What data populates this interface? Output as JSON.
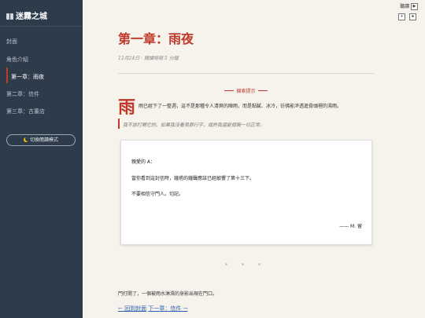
{
  "sidebar": {
    "brand": "迷霧之城",
    "items": [
      {
        "label": "封面"
      },
      {
        "label": "角色介紹"
      },
      {
        "label": "第一章：雨夜"
      },
      {
        "label": "第二章：信件"
      },
      {
        "label": "第三章：古董店"
      }
    ],
    "active_index": 2,
    "theme_button": "切換閱讀模式"
  },
  "topbar": {
    "label": "聽讀",
    "play_icon": "▶",
    "buttons": [
      "⏸",
      "⏹"
    ]
  },
  "chapter": {
    "title": "第一章：雨夜",
    "meta": "12月24日 · 閱讀時間 5 分鐘",
    "ornament": "線索提示",
    "dropcap": "雨",
    "para1": "雨已經下了一整週，這不是那種令人清爽的陣雨，而是黏膩、冰冷，彷彿能滲透進骨頭裡的濕雨。",
    "quote": "我不該打開它的，如果我沒看見那行字，或許我還能假裝一切正常。",
    "letter": {
      "greeting": "親愛的 A：",
      "line1": "當你看到這封信時，鐘塔的鐘聲應該已經敲響了第十三下。",
      "line2": "不要相信守門人。切記。",
      "signature": "—— M. 留"
    },
    "divider": "* * *",
    "para2": "門打開了，一個被雨水淋濕的身影出現在門口。",
    "prev_link": "← 回到封面",
    "next_link": "下一章：信件 →"
  },
  "colors": {
    "sidebar_bg": "#2e3b4b",
    "accent": "#c0392b",
    "page_bg": "#f6f3ec",
    "link": "#2a5db0"
  }
}
